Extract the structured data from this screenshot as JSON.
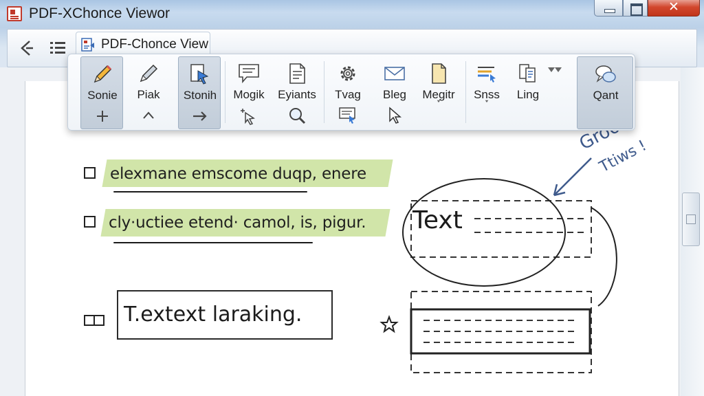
{
  "window": {
    "title": "PDF-XChonce Viewor"
  },
  "tab": {
    "label": "PDF-Chonce View"
  },
  "ribbon": {
    "tools": [
      {
        "label": "Sonie"
      },
      {
        "label": "Piak"
      },
      {
        "label": "Stonih"
      },
      {
        "label": "Mogik"
      },
      {
        "label": "Eyiants"
      },
      {
        "label": "Tvag"
      },
      {
        "label": "Bleg"
      },
      {
        "label": "Megitr"
      },
      {
        "label": "Snss"
      },
      {
        "label": "Ling"
      },
      {
        "label": "Qant"
      }
    ]
  },
  "document": {
    "items": [
      {
        "text": "elexmane emscome duqp, enere"
      },
      {
        "text": "cly·uctiee etend· camol, is, pigur."
      }
    ],
    "textbox": {
      "text": "T.extext laraking."
    },
    "annotation_box_text": "Text",
    "note_line1": "Groot",
    "note_line2": "Ttiws !"
  },
  "colors": {
    "highlight": "#c9e09a",
    "note_ink": "#3e5a8c",
    "close_button": "#c9402a"
  }
}
